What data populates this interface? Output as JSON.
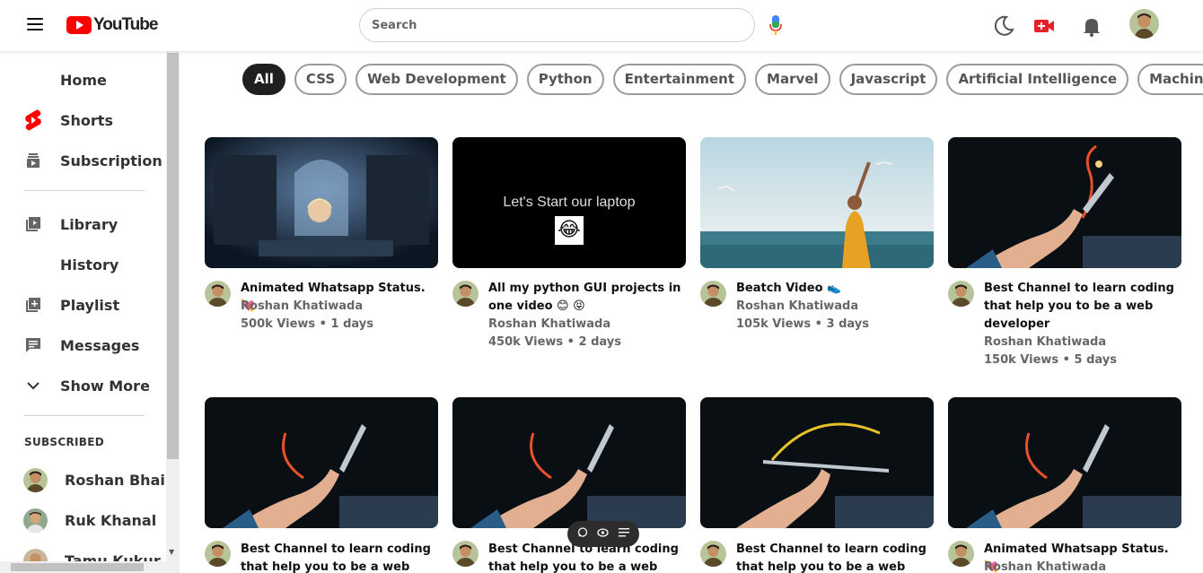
{
  "header": {
    "logo_text": "YouTube",
    "search_placeholder": "Search"
  },
  "sidebar": {
    "items": [
      {
        "label": "Home",
        "icon": "home-icon"
      },
      {
        "label": "Shorts",
        "icon": "shorts-icon"
      },
      {
        "label": "Subscription",
        "icon": "subscription-icon"
      },
      {
        "label": "Library",
        "icon": "library-icon"
      },
      {
        "label": "History",
        "icon": "history-icon"
      },
      {
        "label": "Playlist",
        "icon": "playlist-icon"
      },
      {
        "label": "Messages",
        "icon": "messages-icon"
      },
      {
        "label": "Show More",
        "icon": "chevron-down-icon"
      }
    ],
    "subscribed_heading": "SUBSCRIBED",
    "subscriptions": [
      {
        "name": "Roshan Bhai"
      },
      {
        "name": "Ruk Khanal"
      },
      {
        "name": "Tamu Kukur"
      }
    ]
  },
  "chips": [
    "All",
    "CSS",
    "Web Development",
    "Python",
    "Entertainment",
    "Marvel",
    "Javascript",
    "Artificial Intelligence",
    "Machine Learning"
  ],
  "videos": [
    {
      "title": "Animated Whatsapp Status. 💘",
      "channel": "Roshan Khatiwada",
      "meta": "500k Views • 1 days"
    },
    {
      "title": "All my python GUI projects in one video 😊 😝",
      "channel": "Roshan Khatiwada",
      "meta": "450k Views • 2 days",
      "thumb_text": "Let's Start our laptop",
      "thumb_emoji": "😂"
    },
    {
      "title": "Beatch Video 👟",
      "channel": "Roshan Khatiwada",
      "meta": "105k Views • 3 days"
    },
    {
      "title": "Best Channel to learn coding that help you to be a web developer",
      "channel": "Roshan Khatiwada",
      "meta": "150k Views • 5 days"
    },
    {
      "title": "Best Channel to learn coding that help you to be a web developer",
      "channel": "",
      "meta": ""
    },
    {
      "title": "Best Channel to learn coding that help you to be a web developer",
      "channel": "",
      "meta": ""
    },
    {
      "title": "Best Channel to learn coding that help you to be a web developer",
      "channel": "",
      "meta": ""
    },
    {
      "title": "Animated Whatsapp Status. 💘",
      "channel": "Roshan Khatiwada",
      "meta": ""
    }
  ],
  "colors": {
    "brand_red": "#ff0000",
    "chip_active_bg": "#1f1f1f"
  }
}
